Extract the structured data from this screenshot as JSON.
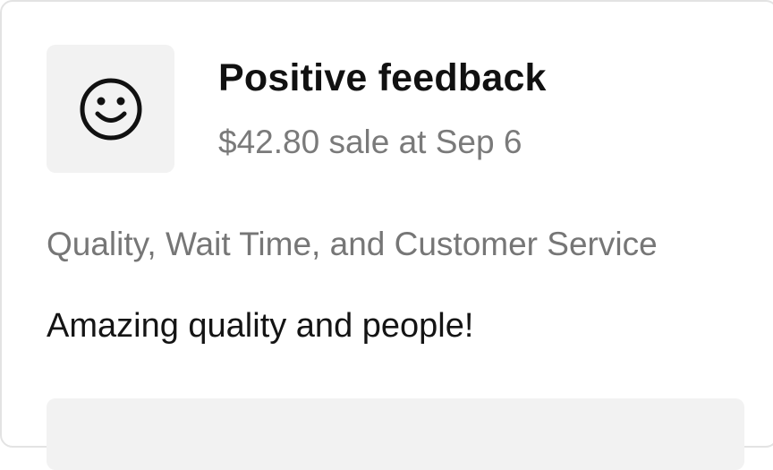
{
  "feedback": {
    "icon": "smiley-face-icon",
    "title": "Positive feedback",
    "sale_info": "$42.80 sale at Sep 6",
    "categories": "Quality, Wait Time, and Customer Service",
    "comment": "Amazing quality and people!"
  },
  "colors": {
    "title": "#111111",
    "secondary_text": "#767676",
    "tile_background": "#f2f2f2",
    "card_border": "#e3e3e3"
  }
}
